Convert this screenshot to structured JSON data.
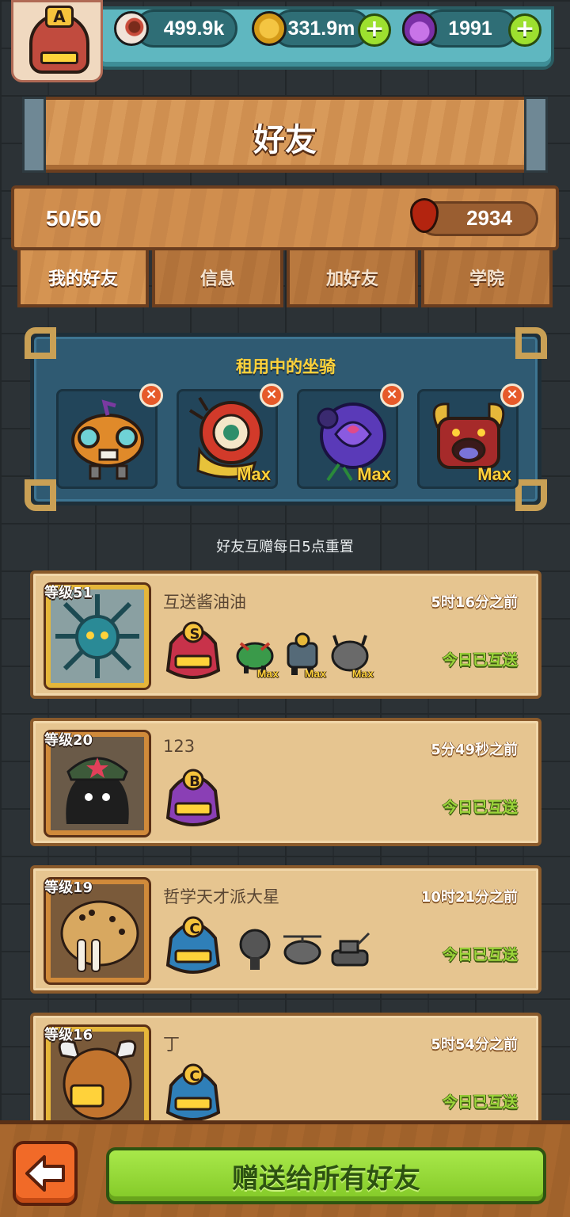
{
  "resources": {
    "eyes": "499.9k",
    "coins": "331.9m",
    "potions": "1991"
  },
  "player": {
    "grade": "A"
  },
  "title": "好友",
  "friend_count": "50/50",
  "blood_points": "2934",
  "tabs": [
    "我的好友",
    "信息",
    "加好友",
    "学院"
  ],
  "active_tab": 0,
  "rented_mounts": {
    "title": "租用中的坐骑",
    "slots": [
      {
        "name": "pumpkin-robot",
        "max": ""
      },
      {
        "name": "lion-dance",
        "max": "Max"
      },
      {
        "name": "purple-rose",
        "max": "Max"
      },
      {
        "name": "horned-demon",
        "max": "Max"
      }
    ]
  },
  "reset_note": "好友互赠每日5点重置",
  "friends": [
    {
      "level": "等级51",
      "name": "互送酱油油",
      "time": "5时16分之前",
      "status": "今日已互送",
      "grade": "S",
      "grade_color": "#c8324a",
      "avatar": "sea-urchin",
      "mounts": [
        {
          "name": "green-dragon",
          "max": "Max"
        },
        {
          "name": "armored-knight",
          "max": "Max"
        },
        {
          "name": "grey-beast",
          "max": "Max"
        }
      ]
    },
    {
      "level": "等级20",
      "name": "123",
      "time": "5分49秒之前",
      "status": "今日已互送",
      "grade": "B",
      "grade_color": "#8a3fb5",
      "avatar": "soldier-blob",
      "mounts": []
    },
    {
      "level": "等级19",
      "name": "哲学天才派大星",
      "time": "10时21分之前",
      "status": "今日已互送",
      "grade": "C",
      "grade_color": "#2f7fb8",
      "avatar": "leopard-walrus",
      "mounts": [
        {
          "name": "grey-tree",
          "max": ""
        },
        {
          "name": "grey-helicopter",
          "max": ""
        },
        {
          "name": "grey-tank",
          "max": ""
        }
      ]
    },
    {
      "level": "等级16",
      "name": "丁",
      "time": "5时54分之前",
      "status": "今日已互送",
      "grade": "C",
      "grade_color": "#2f7fb8",
      "avatar": "yak",
      "mounts": []
    }
  ],
  "gift_all_label": "赠送给所有好友",
  "colors": {
    "accent_green": "#9bd43a",
    "wood": "#d89a5a",
    "panel_blue": "#2f5a72",
    "gold_text": "#ffd23a"
  }
}
